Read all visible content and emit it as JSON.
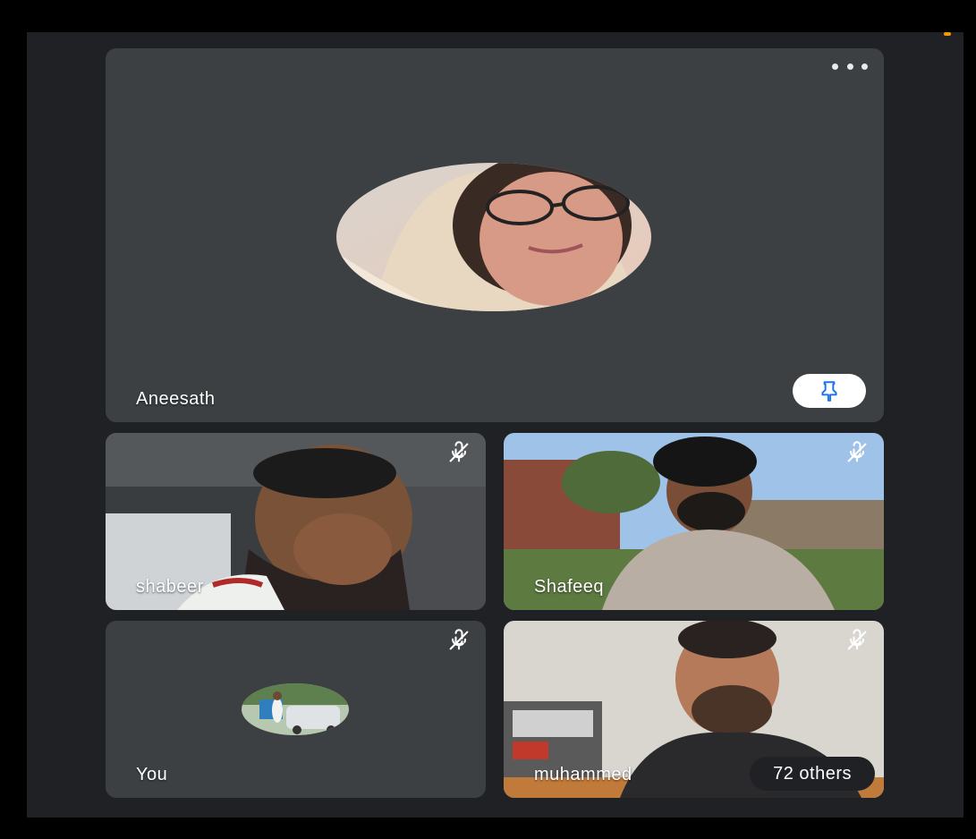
{
  "meeting": {
    "main_tile": {
      "name": "Aneesath"
    },
    "tiles": [
      {
        "name": "shabeer",
        "muted": true
      },
      {
        "name": "Shafeeq",
        "muted": true
      },
      {
        "name": "You",
        "muted": true
      },
      {
        "name": "muhammed",
        "muted": true
      }
    ],
    "others": {
      "label": "72 others"
    }
  },
  "colors": {
    "background": "#202124",
    "tile": "#3c4043",
    "pin_icon": "#1a73e8",
    "status_dot": "#f29900"
  },
  "icons": {
    "more_options": "more-horiz-icon",
    "pin": "pin-icon",
    "muted": "mic-off-icon"
  }
}
